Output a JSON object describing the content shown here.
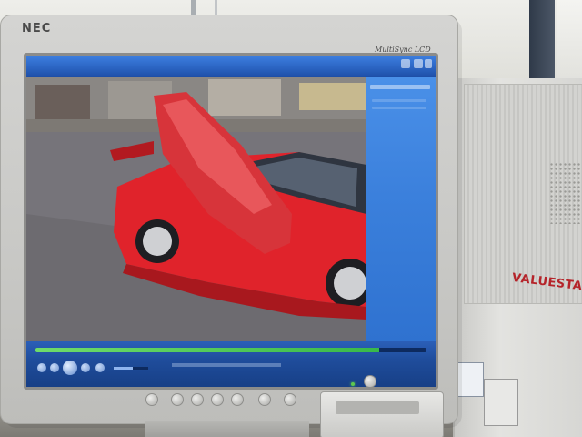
{
  "monitor": {
    "brand": "NEC",
    "model": "MultiSync LCD"
  },
  "pc": {
    "brand": "VALUESTAR"
  },
  "player": {
    "seek_progress": 0.88,
    "volume_level": 0.55
  },
  "colors": {
    "player_chrome": "#2a62c0",
    "playlist_panel": "#3b80dc",
    "car_body": "#e0232b",
    "pc_brand": "#b5242a"
  }
}
